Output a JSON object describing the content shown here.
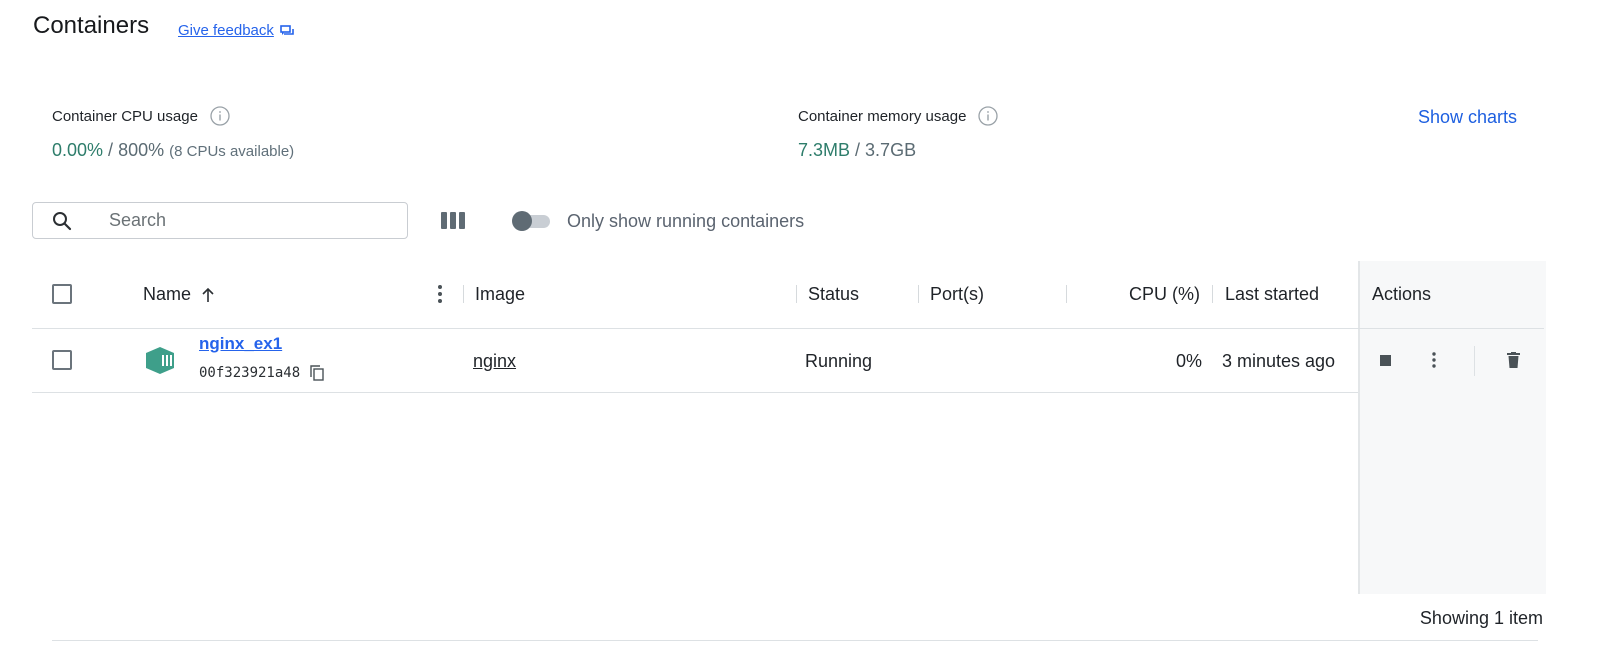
{
  "header": {
    "title": "Containers",
    "feedback_label": "Give feedback"
  },
  "stats": {
    "cpu": {
      "label": "Container CPU usage",
      "used": "0.00%",
      "separator": " / ",
      "total": "800%",
      "note": "(8 CPUs available)"
    },
    "memory": {
      "label": "Container memory usage",
      "used": "7.3MB",
      "separator": " / ",
      "total": "3.7GB"
    },
    "show_charts_label": "Show charts"
  },
  "toolbar": {
    "search_placeholder": "Search",
    "search_value": "",
    "toggle_label": "Only show running containers",
    "toggle_on": false
  },
  "table": {
    "columns": {
      "name": "Name",
      "image": "Image",
      "status": "Status",
      "ports": "Port(s)",
      "cpu": "CPU (%)",
      "last_started": "Last started",
      "actions": "Actions"
    },
    "rows": [
      {
        "name": "nginx_ex1",
        "id": "00f323921a48",
        "image": "nginx",
        "status": "Running",
        "ports": "",
        "cpu": "0%",
        "last_started": "3 minutes ago"
      }
    ],
    "footer": "Showing 1 item"
  },
  "colors": {
    "accent": "#2563eb",
    "green": "#2e7d6b",
    "container_icon": "#3e9f8a"
  }
}
